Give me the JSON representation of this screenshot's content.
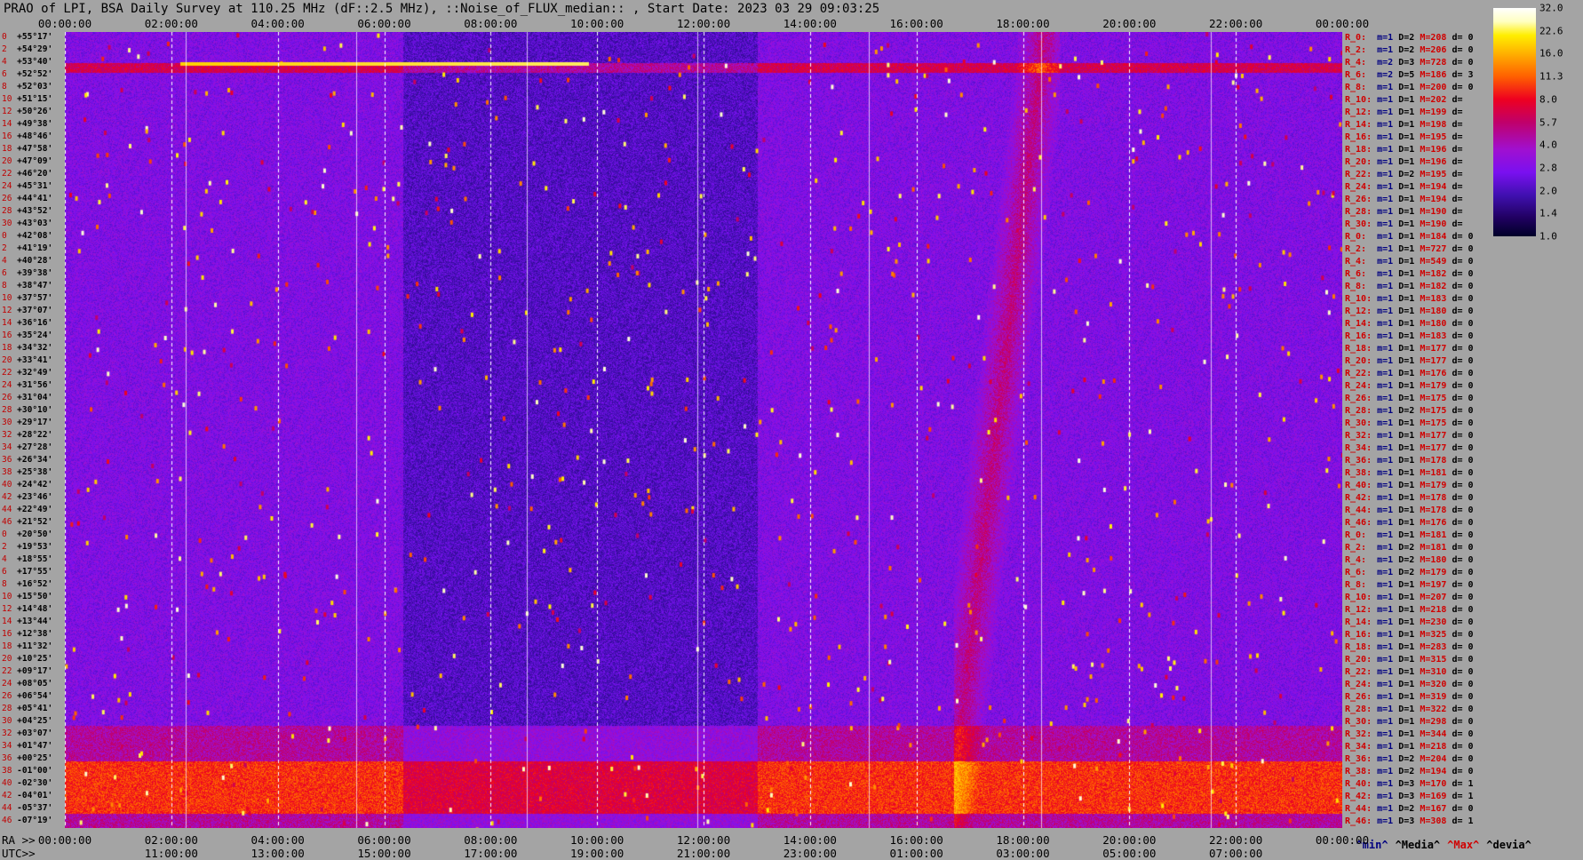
{
  "title": "PRAO of LPI, BSA Daily Survey at 110.25 MHz (dF::2.5 MHz), ::Noise_of_FLUX_median:: , Start Date: 2023 03 29 09:03:25",
  "chart_data": {
    "type": "heatmap",
    "title": "PRAO of LPI, BSA Daily Survey at 110.25 MHz (dF::2.5 MHz), ::Noise_of_FLUX_median:: , Start Date: 2023 03 29 09:03:25",
    "x_top_ticks": [
      "00:00:00",
      "02:00:00",
      "04:00:00",
      "06:00:00",
      "08:00:00",
      "10:00:00",
      "12:00:00",
      "14:00:00",
      "16:00:00",
      "18:00:00",
      "20:00:00",
      "22:00:00",
      "00:00:00"
    ],
    "ra_ticks": [
      "00:00:00",
      "02:00:00",
      "04:00:00",
      "06:00:00",
      "08:00:00",
      "10:00:00",
      "12:00:00",
      "14:00:00",
      "16:00:00",
      "18:00:00",
      "20:00:00",
      "22:00:00",
      "00:00:00"
    ],
    "ra_prefix": "RA >>",
    "utc_prefix": "UTC>>",
    "utc_ticks": [
      "11:00:00",
      "13:00:00",
      "15:00:00",
      "17:00:00",
      "19:00:00",
      "21:00:00",
      "23:00:00",
      "01:00:00",
      "03:00:00",
      "05:00:00",
      "07:00:00"
    ],
    "declinations": [
      {
        "i": "0",
        "d": "+55°17'"
      },
      {
        "i": "2",
        "d": "+54°29'"
      },
      {
        "i": "4",
        "d": "+53°40'"
      },
      {
        "i": "6",
        "d": "+52°52'"
      },
      {
        "i": "8",
        "d": "+52°03'"
      },
      {
        "i": "10",
        "d": "+51°15'"
      },
      {
        "i": "12",
        "d": "+50°26'"
      },
      {
        "i": "14",
        "d": "+49°38'"
      },
      {
        "i": "16",
        "d": "+48°46'"
      },
      {
        "i": "18",
        "d": "+47°58'"
      },
      {
        "i": "20",
        "d": "+47°09'"
      },
      {
        "i": "22",
        "d": "+46°20'"
      },
      {
        "i": "24",
        "d": "+45°31'"
      },
      {
        "i": "26",
        "d": "+44°41'"
      },
      {
        "i": "28",
        "d": "+43°52'"
      },
      {
        "i": "30",
        "d": "+43°03'"
      },
      {
        "i": "0",
        "d": "+42°08'"
      },
      {
        "i": "2",
        "d": "+41°19'"
      },
      {
        "i": "4",
        "d": "+40°28'"
      },
      {
        "i": "6",
        "d": "+39°38'"
      },
      {
        "i": "8",
        "d": "+38°47'"
      },
      {
        "i": "10",
        "d": "+37°57'"
      },
      {
        "i": "12",
        "d": "+37°07'"
      },
      {
        "i": "14",
        "d": "+36°16'"
      },
      {
        "i": "16",
        "d": "+35°24'"
      },
      {
        "i": "18",
        "d": "+34°32'"
      },
      {
        "i": "20",
        "d": "+33°41'"
      },
      {
        "i": "22",
        "d": "+32°49'"
      },
      {
        "i": "24",
        "d": "+31°56'"
      },
      {
        "i": "26",
        "d": "+31°04'"
      },
      {
        "i": "28",
        "d": "+30°10'"
      },
      {
        "i": "30",
        "d": "+29°17'"
      },
      {
        "i": "32",
        "d": "+28°22'"
      },
      {
        "i": "34",
        "d": "+27°28'"
      },
      {
        "i": "36",
        "d": "+26°34'"
      },
      {
        "i": "38",
        "d": "+25°38'"
      },
      {
        "i": "40",
        "d": "+24°42'"
      },
      {
        "i": "42",
        "d": "+23°46'"
      },
      {
        "i": "44",
        "d": "+22°49'"
      },
      {
        "i": "46",
        "d": "+21°52'"
      },
      {
        "i": "0",
        "d": "+20°50'"
      },
      {
        "i": "2",
        "d": "+19°53'"
      },
      {
        "i": "4",
        "d": "+18°55'"
      },
      {
        "i": "6",
        "d": "+17°55'"
      },
      {
        "i": "8",
        "d": "+16°52'"
      },
      {
        "i": "10",
        "d": "+15°50'"
      },
      {
        "i": "12",
        "d": "+14°48'"
      },
      {
        "i": "14",
        "d": "+13°44'"
      },
      {
        "i": "16",
        "d": "+12°38'"
      },
      {
        "i": "18",
        "d": "+11°32'"
      },
      {
        "i": "20",
        "d": "+10°25'"
      },
      {
        "i": "22",
        "d": "+09°17'"
      },
      {
        "i": "24",
        "d": "+08°05'"
      },
      {
        "i": "26",
        "d": "+06°54'"
      },
      {
        "i": "28",
        "d": "+05°41'"
      },
      {
        "i": "30",
        "d": "+04°25'"
      },
      {
        "i": "32",
        "d": "+03°07'"
      },
      {
        "i": "34",
        "d": "+01°47'"
      },
      {
        "i": "36",
        "d": "+00°25'"
      },
      {
        "i": "38",
        "d": "-01°00'"
      },
      {
        "i": "40",
        "d": "-02°30'"
      },
      {
        "i": "42",
        "d": "-04°01'"
      },
      {
        "i": "44",
        "d": "-05°37'"
      },
      {
        "i": "46",
        "d": "-07°19'"
      }
    ],
    "rows": [
      {
        "r": "R_0:",
        "min": "m=1",
        "med": "D=2",
        "max": "M=208",
        "dev": "d= 0"
      },
      {
        "r": "R_2:",
        "min": "m=1",
        "med": "D=2",
        "max": "M=206",
        "dev": "d= 0"
      },
      {
        "r": "R_4:",
        "min": "m=2",
        "med": "D=3",
        "max": "M=728",
        "dev": "d= 0"
      },
      {
        "r": "R_6:",
        "min": "m=2",
        "med": "D=5",
        "max": "M=186",
        "dev": "d= 3"
      },
      {
        "r": "R_8:",
        "min": "m=1",
        "med": "D=1",
        "max": "M=200",
        "dev": "d= 0"
      },
      {
        "r": "R_10:",
        "min": "m=1",
        "med": "D=1",
        "max": "M=202",
        "dev": "d="
      },
      {
        "r": "R_12:",
        "min": "m=1",
        "med": "D=1",
        "max": "M=199",
        "dev": "d="
      },
      {
        "r": "R_14:",
        "min": "m=1",
        "med": "D=1",
        "max": "M=198",
        "dev": "d="
      },
      {
        "r": "R_16:",
        "min": "m=1",
        "med": "D=1",
        "max": "M=195",
        "dev": "d="
      },
      {
        "r": "R_18:",
        "min": "m=1",
        "med": "D=1",
        "max": "M=196",
        "dev": "d="
      },
      {
        "r": "R_20:",
        "min": "m=1",
        "med": "D=1",
        "max": "M=196",
        "dev": "d="
      },
      {
        "r": "R_22:",
        "min": "m=1",
        "med": "D=2",
        "max": "M=195",
        "dev": "d="
      },
      {
        "r": "R_24:",
        "min": "m=1",
        "med": "D=1",
        "max": "M=194",
        "dev": "d="
      },
      {
        "r": "R_26:",
        "min": "m=1",
        "med": "D=1",
        "max": "M=194",
        "dev": "d="
      },
      {
        "r": "R_28:",
        "min": "m=1",
        "med": "D=1",
        "max": "M=190",
        "dev": "d="
      },
      {
        "r": "R_30:",
        "min": "m=1",
        "med": "D=1",
        "max": "M=190",
        "dev": "d="
      },
      {
        "r": "R_0:",
        "min": "m=1",
        "med": "D=1",
        "max": "M=184",
        "dev": "d= 0"
      },
      {
        "r": "R_2:",
        "min": "m=1",
        "med": "D=1",
        "max": "M=727",
        "dev": "d= 0"
      },
      {
        "r": "R_4:",
        "min": "m=1",
        "med": "D=1",
        "max": "M=549",
        "dev": "d= 0"
      },
      {
        "r": "R_6:",
        "min": "m=1",
        "med": "D=1",
        "max": "M=182",
        "dev": "d= 0"
      },
      {
        "r": "R_8:",
        "min": "m=1",
        "med": "D=1",
        "max": "M=182",
        "dev": "d= 0"
      },
      {
        "r": "R_10:",
        "min": "m=1",
        "med": "D=1",
        "max": "M=183",
        "dev": "d= 0"
      },
      {
        "r": "R_12:",
        "min": "m=1",
        "med": "D=1",
        "max": "M=180",
        "dev": "d= 0"
      },
      {
        "r": "R_14:",
        "min": "m=1",
        "med": "D=1",
        "max": "M=180",
        "dev": "d= 0"
      },
      {
        "r": "R_16:",
        "min": "m=1",
        "med": "D=1",
        "max": "M=183",
        "dev": "d= 0"
      },
      {
        "r": "R_18:",
        "min": "m=1",
        "med": "D=1",
        "max": "M=177",
        "dev": "d= 0"
      },
      {
        "r": "R_20:",
        "min": "m=1",
        "med": "D=1",
        "max": "M=177",
        "dev": "d= 0"
      },
      {
        "r": "R_22:",
        "min": "m=1",
        "med": "D=1",
        "max": "M=176",
        "dev": "d= 0"
      },
      {
        "r": "R_24:",
        "min": "m=1",
        "med": "D=1",
        "max": "M=179",
        "dev": "d= 0"
      },
      {
        "r": "R_26:",
        "min": "m=1",
        "med": "D=1",
        "max": "M=175",
        "dev": "d= 0"
      },
      {
        "r": "R_28:",
        "min": "m=1",
        "med": "D=2",
        "max": "M=175",
        "dev": "d= 0"
      },
      {
        "r": "R_30:",
        "min": "m=1",
        "med": "D=1",
        "max": "M=175",
        "dev": "d= 0"
      },
      {
        "r": "R_32:",
        "min": "m=1",
        "med": "D=1",
        "max": "M=177",
        "dev": "d= 0"
      },
      {
        "r": "R_34:",
        "min": "m=1",
        "med": "D=1",
        "max": "M=177",
        "dev": "d= 0"
      },
      {
        "r": "R_36:",
        "min": "m=1",
        "med": "D=1",
        "max": "M=178",
        "dev": "d= 0"
      },
      {
        "r": "R_38:",
        "min": "m=1",
        "med": "D=1",
        "max": "M=181",
        "dev": "d= 0"
      },
      {
        "r": "R_40:",
        "min": "m=1",
        "med": "D=1",
        "max": "M=179",
        "dev": "d= 0"
      },
      {
        "r": "R_42:",
        "min": "m=1",
        "med": "D=1",
        "max": "M=178",
        "dev": "d= 0"
      },
      {
        "r": "R_44:",
        "min": "m=1",
        "med": "D=1",
        "max": "M=178",
        "dev": "d= 0"
      },
      {
        "r": "R_46:",
        "min": "m=1",
        "med": "D=1",
        "max": "M=176",
        "dev": "d= 0"
      },
      {
        "r": "R_0:",
        "min": "m=1",
        "med": "D=1",
        "max": "M=181",
        "dev": "d= 0"
      },
      {
        "r": "R_2:",
        "min": "m=1",
        "med": "D=2",
        "max": "M=181",
        "dev": "d= 0"
      },
      {
        "r": "R_4:",
        "min": "m=1",
        "med": "D=2",
        "max": "M=180",
        "dev": "d= 0"
      },
      {
        "r": "R_6:",
        "min": "m=1",
        "med": "D=2",
        "max": "M=179",
        "dev": "d= 0"
      },
      {
        "r": "R_8:",
        "min": "m=1",
        "med": "D=1",
        "max": "M=197",
        "dev": "d= 0"
      },
      {
        "r": "R_10:",
        "min": "m=1",
        "med": "D=1",
        "max": "M=207",
        "dev": "d= 0"
      },
      {
        "r": "R_12:",
        "min": "m=1",
        "med": "D=1",
        "max": "M=218",
        "dev": "d= 0"
      },
      {
        "r": "R_14:",
        "min": "m=1",
        "med": "D=1",
        "max": "M=230",
        "dev": "d= 0"
      },
      {
        "r": "R_16:",
        "min": "m=1",
        "med": "D=1",
        "max": "M=325",
        "dev": "d= 0"
      },
      {
        "r": "R_18:",
        "min": "m=1",
        "med": "D=1",
        "max": "M=283",
        "dev": "d= 0"
      },
      {
        "r": "R_20:",
        "min": "m=1",
        "med": "D=1",
        "max": "M=315",
        "dev": "d= 0"
      },
      {
        "r": "R_22:",
        "min": "m=1",
        "med": "D=1",
        "max": "M=310",
        "dev": "d= 0"
      },
      {
        "r": "R_24:",
        "min": "m=1",
        "med": "D=1",
        "max": "M=320",
        "dev": "d= 0"
      },
      {
        "r": "R_26:",
        "min": "m=1",
        "med": "D=1",
        "max": "M=319",
        "dev": "d= 0"
      },
      {
        "r": "R_28:",
        "min": "m=1",
        "med": "D=1",
        "max": "M=322",
        "dev": "d= 0"
      },
      {
        "r": "R_30:",
        "min": "m=1",
        "med": "D=1",
        "max": "M=298",
        "dev": "d= 0"
      },
      {
        "r": "R_32:",
        "min": "m=1",
        "med": "D=1",
        "max": "M=344",
        "dev": "d= 0"
      },
      {
        "r": "R_34:",
        "min": "m=1",
        "med": "D=1",
        "max": "M=218",
        "dev": "d= 0"
      },
      {
        "r": "R_36:",
        "min": "m=1",
        "med": "D=2",
        "max": "M=204",
        "dev": "d= 0"
      },
      {
        "r": "R_38:",
        "min": "m=1",
        "med": "D=2",
        "max": "M=194",
        "dev": "d= 0"
      },
      {
        "r": "R_40:",
        "min": "m=1",
        "med": "D=3",
        "max": "M=170",
        "dev": "d= 1"
      },
      {
        "r": "R_42:",
        "min": "m=1",
        "med": "D=3",
        "max": "M=169",
        "dev": "d= 1"
      },
      {
        "r": "R_44:",
        "min": "m=1",
        "med": "D=2",
        "max": "M=167",
        "dev": "d= 0"
      },
      {
        "r": "R_46:",
        "min": "m=1",
        "med": "D=3",
        "max": "M=308",
        "dev": "d= 1"
      }
    ],
    "legend_labels": [
      "^min^",
      "^Media^",
      "^Max^",
      "^devia^"
    ],
    "colorbar_ticks": [
      "32.0",
      "22.6",
      "16.0",
      "11.3",
      "8.0",
      "5.7",
      "4.0",
      "2.8",
      "2.0",
      "1.4",
      "1.0"
    ],
    "colorbar_range": [
      1.0,
      32.0
    ],
    "colorbar_scale": "log",
    "colormap": [
      "#000028",
      "#200060",
      "#4010b0",
      "#7a10f0",
      "#a010d0",
      "#c0006a",
      "#ee0020",
      "#ff6000",
      "#ffb000",
      "#ffee00",
      "#ffffc0",
      "#ffffff"
    ],
    "vertical_line_color": "#ffffff",
    "background_color": "#a4a4a4"
  }
}
